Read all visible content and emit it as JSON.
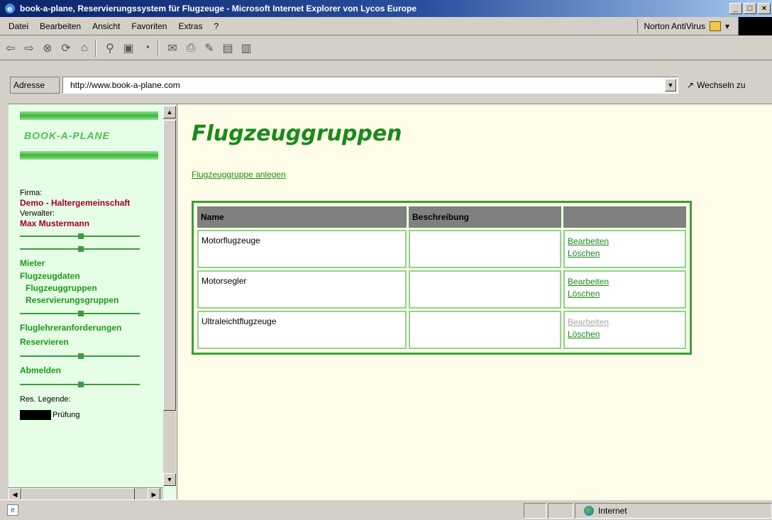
{
  "window": {
    "title": "book-a-plane, Reservierungssystem für Flugzeuge - Microsoft Internet Explorer von Lycos Europe",
    "buttons": [
      "_",
      "□",
      "×"
    ]
  },
  "menubar": {
    "items": [
      {
        "label": "Datei"
      },
      {
        "label": "Bearbeiten"
      },
      {
        "label": "Ansicht"
      },
      {
        "label": "Favoriten"
      },
      {
        "label": "Extras"
      },
      {
        "label": "?"
      }
    ],
    "norton": "Norton AntiVirus"
  },
  "toolbar": {
    "icons": [
      "back-icon",
      "forward-icon",
      "stop-icon",
      "refresh-icon",
      "home-icon",
      "search-icon",
      "favorites-icon",
      "history-icon",
      "mail-icon",
      "print-icon",
      "edit-icon",
      "discuss-icon",
      "messenger-icon"
    ]
  },
  "address": {
    "label": "Adresse",
    "url": "http://www.book-a-plane.com",
    "go_label": "Wechseln zu"
  },
  "sidebar": {
    "logo": "BOOK-A-PLANE",
    "firma_label": "Firma:",
    "firma_value": "Demo - Haltergemeinschaft",
    "verwalter_label": "Verwalter:",
    "verwalter_value": "Max Mustermann",
    "links": {
      "mieter": "Mieter",
      "flugzeugdaten": "Flugzeugdaten",
      "flugzeuggruppen": "Flugzeuggruppen",
      "reservierungsgruppen": "Reservierungsgruppen",
      "fluglehrer": "Fluglehreranforderungen",
      "reservieren": "Reservieren",
      "abmelden": "Abmelden"
    },
    "legend_label": "Res. Legende:",
    "legend_item": "Prüfung"
  },
  "main": {
    "title": "Flugzeuggruppen",
    "create_link": "Flugzeuggruppe anlegen",
    "table": {
      "headers": [
        "Name",
        "Beschreibung",
        ""
      ],
      "rows": [
        {
          "name": "Motorflugzeuge",
          "beschreibung": "",
          "edit": "Bearbeiten",
          "delete": "Löschen",
          "edit_enabled": true
        },
        {
          "name": "Motorsegler",
          "beschreibung": "",
          "edit": "Bearbeiten",
          "delete": "Löschen",
          "edit_enabled": true
        },
        {
          "name": "Ultraleichtflugzeuge",
          "beschreibung": "",
          "edit": "Bearbeiten",
          "delete": "Löschen",
          "edit_enabled": false
        }
      ]
    }
  },
  "statusbar": {
    "zone": "Internet"
  }
}
